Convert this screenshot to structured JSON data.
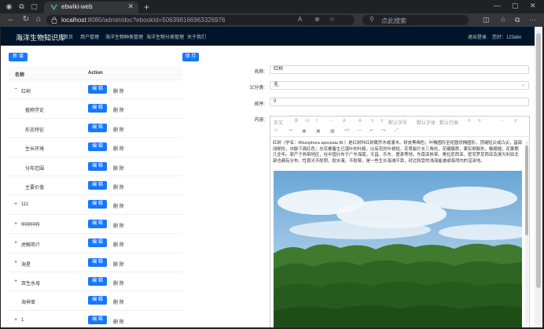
{
  "browser": {
    "tab_title": "ebwiki-web",
    "url_host": "localhost",
    "url_rest": ":8080/admin/doc?ebookId=506398166963326976",
    "search_placeholder": "点此搜索"
  },
  "header": {
    "brand": "海洋生物知识库",
    "menu": [
      "首页",
      "用户管理",
      "海洋生物种类管理",
      "海洋生物分类管理",
      "关于我们"
    ],
    "logout": "退出登录",
    "welcome": "您好：123abc"
  },
  "toolbar": {
    "new_label": "新 增",
    "save_label": "保 存"
  },
  "table": {
    "col_name": "名称",
    "col_action": "Action",
    "edit_label": "编 辑",
    "delete_label": "删 除",
    "rows": [
      {
        "expander": "−",
        "name": "红树"
      },
      {
        "expander": "",
        "name": "植物学史"
      },
      {
        "expander": "",
        "name": "形态特征"
      },
      {
        "expander": "",
        "name": "生长环境"
      },
      {
        "expander": "",
        "name": "分布范围"
      },
      {
        "expander": "",
        "name": "主要价值"
      },
      {
        "expander": "+",
        "name": "111"
      },
      {
        "expander": "+",
        "name": "qqqqqqq"
      },
      {
        "expander": "+",
        "name": "虎鲸简介"
      },
      {
        "expander": "+",
        "name": "海星"
      },
      {
        "expander": "+",
        "name": "双生水母"
      },
      {
        "expander": "",
        "name": "海神草"
      },
      {
        "expander": "+",
        "name": "1"
      }
    ]
  },
  "form": {
    "name_label": "名称:",
    "name_value": "红树",
    "parent_label": "父分类:",
    "parent_value": "无",
    "sort_label": "排序:",
    "sort_value": "0",
    "content_label": "内容:"
  },
  "editor": {
    "tb_row1": [
      "正文",
      "B",
      "U",
      "I",
      "···",
      "A",
      "A",
      "≡",
      "≡",
      "默认字号",
      "默认字体",
      "默认行高",
      "≡",
      "≡",
      "···",
      "≡"
    ],
    "tb_row2": [
      "☺",
      "∞",
      "▣",
      "▣",
      "▦",
      "<>",
      "—",
      "↶",
      "↷",
      "⤢"
    ],
    "body_text": "红树（学名：Rhizophora apiculata Bl.）是红树科红树属乔木或灌木。树皮黑褐色；叶椭圆形至矩圆状椭圆形，顶端短尖或凸尖，基部阔楔形，中脉下面红色；总花梗着生已落叶的叶腋，比有花的叶柄短，花萼裂片长三角形，花瓣膜质，果实倒梨形，略粗糙；花果期几全年。原产于热带地区，在中国分布于广东海南，文昌、乐东、崖县等地，东南亚热带、美拉尼西亚、密克罗尼西亚及澳大利亚北部也都有分布。性喜光不耐阴，耐水淹，不耐寒，是一些生长海滩平靠，封过和受的浅海盐滩或海湾内的沼泽地。"
  },
  "colors": {
    "header_bg": "#001529",
    "primary": "#1677ff"
  }
}
